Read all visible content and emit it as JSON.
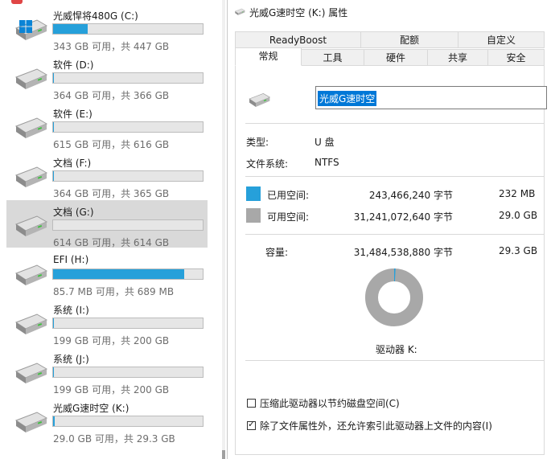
{
  "drives": [
    {
      "name": "光威悍将480G (C:)",
      "space": "343 GB 可用，共 447 GB",
      "used_fraction": 0.233,
      "system": true,
      "selected": false
    },
    {
      "name": "软件 (D:)",
      "space": "364 GB 可用，共 366 GB",
      "used_fraction": 0.005,
      "system": false,
      "selected": false
    },
    {
      "name": "软件 (E:)",
      "space": "615 GB 可用，共 616 GB",
      "used_fraction": 0.002,
      "system": false,
      "selected": false
    },
    {
      "name": "文档 (F:)",
      "space": "364 GB 可用，共 365 GB",
      "used_fraction": 0.003,
      "system": false,
      "selected": false
    },
    {
      "name": "文档 (G:)",
      "space": "614 GB 可用，共 614 GB",
      "used_fraction": 0.0,
      "system": false,
      "selected": true
    },
    {
      "name": "EFI (H:)",
      "space": "85.7 MB 可用，共 689 MB",
      "used_fraction": 0.876,
      "system": false,
      "selected": false
    },
    {
      "name": "系统 (I:)",
      "space": "199 GB 可用，共 200 GB",
      "used_fraction": 0.005,
      "system": false,
      "selected": false
    },
    {
      "name": "系统 (J:)",
      "space": "199 GB 可用，共 200 GB",
      "used_fraction": 0.005,
      "system": false,
      "selected": false
    },
    {
      "name": "光威G速时空 (K:)",
      "space": "29.0 GB 可用，共 29.3 GB",
      "used_fraction": 0.01,
      "system": false,
      "selected": false
    }
  ],
  "dialog": {
    "title": "光威G速时空 (K:) 属性",
    "tabs_row1": [
      "ReadyBoost",
      "配额",
      "自定义"
    ],
    "tabs_row2": [
      "常规",
      "工具",
      "硬件",
      "共享",
      "安全"
    ],
    "active_tab": "常规",
    "volume_name": "光威G速时空",
    "type_label": "类型:",
    "type_value": "U 盘",
    "fs_label": "文件系统:",
    "fs_value": "NTFS",
    "used_label": "已用空间:",
    "used_bytes": "243,466,240 字节",
    "used_size": "232 MB",
    "free_label": "可用空间:",
    "free_bytes": "31,241,072,640 字节",
    "free_size": "29.0 GB",
    "capacity_label": "容量:",
    "capacity_bytes": "31,484,538,880 字节",
    "capacity_size": "29.3 GB",
    "drive_label": "驱动器 K:",
    "used_fraction": 0.0077,
    "compress_label": "压缩此驱动器以节约磁盘空间(C)",
    "compress_checked": false,
    "index_label": "除了文件属性外，还允许索引此驱动器上文件的内容(I)",
    "index_checked": true
  },
  "colors": {
    "used": "#26a0da",
    "free": "#a8a8a8",
    "selection": "#0078d7"
  }
}
